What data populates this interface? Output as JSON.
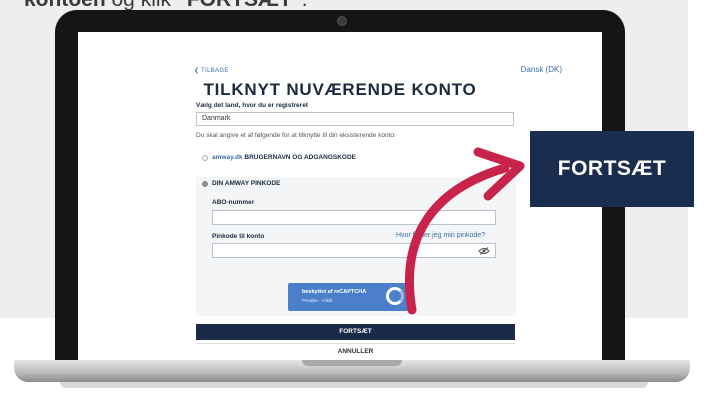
{
  "caption": {
    "bold1": "kontoen",
    "middle": " og klik ",
    "bold2": "\"FORTSÆT\"",
    "end": "."
  },
  "screen": {
    "back_link": "❮ TILBAGE",
    "language": "Dansk (DK)",
    "title": "TILKNYT NUVÆRENDE KONTO",
    "country_label": "Vælg det land, hvor du er registreret",
    "country_value": "Danmark",
    "instruction": "Du skal angive et af følgende for at tilknytte til din eksisterende konto:",
    "option1_link": "amway.dk",
    "option1_text": " BRUGERNAVN OG ADGANGSKODE",
    "option2_text": "DIN AMWAY PINKODE",
    "abo_label": "ABO-nummer",
    "pin_label": "Pinkode til konto",
    "pin_help": "Hvor finder jeg min pinkode?",
    "captcha_line1": "beskyttet af reCAPTCHA",
    "captcha_line2": "Privatliv - Vilkår",
    "continue_button": "FORTSÆT",
    "cancel_button": "ANNULLER"
  },
  "callout": {
    "label": "FORTSÆT"
  },
  "colors": {
    "arrow": "#c8234a",
    "callout_bg": "#1b2d4f",
    "primary_button": "#1b2a48"
  }
}
